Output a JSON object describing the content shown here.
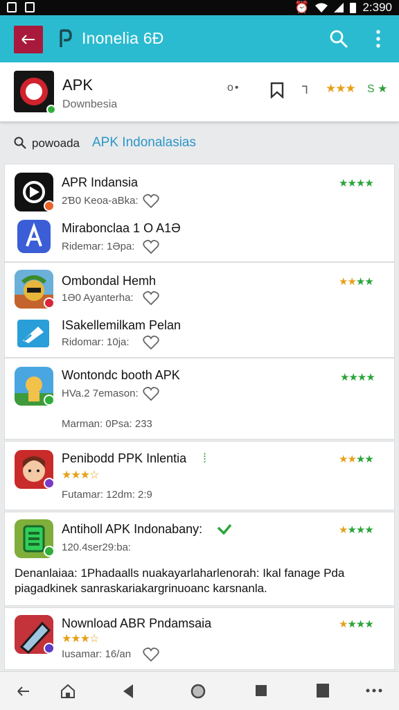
{
  "status_bar": {
    "time": "2:390"
  },
  "app_bar": {
    "title": "Inonelia 6Ð"
  },
  "apk_header": {
    "title": "APK",
    "subtitle": "Downbesia",
    "dots": "o•",
    "pin": "⅂",
    "stars": "★★★",
    "rating": "S ★"
  },
  "search": {
    "label": "powoada",
    "link": "APK Indonalasias"
  },
  "items": [
    {
      "title": "APR Indansia",
      "sub": "2Ɓ0 Keoa-aBka:",
      "rating": "★★★★"
    },
    {
      "title": "Mirabonclaa 1 O A1Ə",
      "sub": "Ridemar: 1Əpa:"
    },
    {
      "title": "Ombondal Hemh",
      "sub": "1Ə0 Ayanterha:",
      "rating": "★★★★"
    },
    {
      "title": "ISakellemilkam Pelan",
      "sub": "Ridomar: 10ja:"
    },
    {
      "title": "Wontondc booth APK",
      "sub": "HVa.2 7emason:",
      "rating": "★★★★"
    },
    {
      "title": "",
      "sub": "Marman: 0Psa: 233"
    },
    {
      "title": "Penibodd PPK Inlentia",
      "sub": "Futamar: 12dm: 2:9",
      "rating": "★★★★",
      "stars": "★★★☆"
    },
    {
      "title": "Antiholl APK Indonabany:",
      "sub": "120.4ser29:ba:",
      "rating": "★★★★"
    },
    {
      "title": "Nownload ABR Pndamsaia",
      "sub": "Iusamar: 16/an",
      "rating": "★★★★",
      "stars": "★★★☆"
    }
  ],
  "description": {
    "line1": "Denanlaiaa: 1Phadaalls nuakayarlaharlenorah: Ikal fanage Pda",
    "line2": "piagadkinek sanraskariakargrinuoanc karsnanla."
  },
  "colors": {
    "accent": "#2bbbd0",
    "back": "#a8193b",
    "star_green": "#2aa43a",
    "star_orange": "#e6a119",
    "link": "#2b96c8"
  },
  "icons": [
    "back-arrow-icon",
    "app-logo-icon",
    "search-icon",
    "more-vert-icon",
    "bookmark-icon",
    "heart-icon",
    "home-icon",
    "nav-back-icon",
    "circle-home-icon",
    "square-recents-icon"
  ]
}
